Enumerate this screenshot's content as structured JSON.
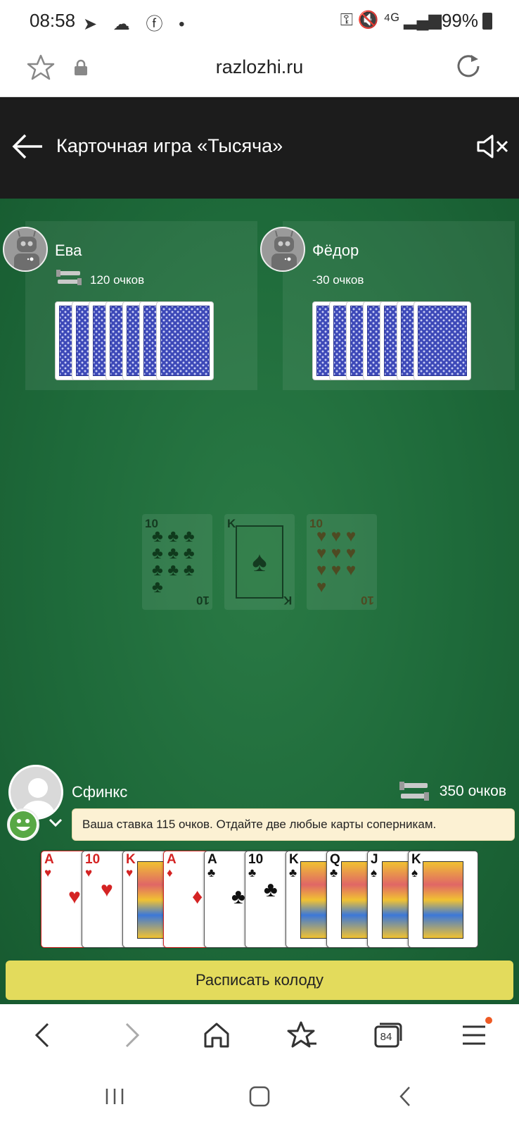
{
  "status_bar": {
    "time": "08:58",
    "left_icons": "➤ ☁ ⓕ •",
    "right_icons": "⚿ 🔇 ⁴ᴳ ▂▄▆",
    "battery": "99%"
  },
  "browser": {
    "url": "razlozhi.ru",
    "tabs_count": "84"
  },
  "header": {
    "title": "Карточная игра «Тысяча»"
  },
  "opponents": [
    {
      "name": "Ева",
      "score": "120 очков"
    },
    {
      "name": "Фёдор",
      "score": "-30 очков"
    }
  ],
  "trick": [
    {
      "rank": "10",
      "suit": "♣",
      "color": "black",
      "pips": "♣ ♣ ♣ ♣ ♣ ♣ ♣ ♣ ♣ ♣"
    },
    {
      "rank": "K",
      "suit": "♠",
      "color": "black",
      "pips": "K"
    },
    {
      "rank": "10",
      "suit": "♥",
      "color": "red",
      "pips": "♥ ♥ ♥ ♥ ♥ ♥ ♥ ♥ ♥ ♥"
    }
  ],
  "me": {
    "name": "Сфинкс",
    "score": "350 очков",
    "message": "Ваша ставка 115 очков. Отдайте две любые карты соперникам."
  },
  "hand": [
    {
      "rank": "A",
      "suit": "♥",
      "color": "red"
    },
    {
      "rank": "10",
      "suit": "♥",
      "color": "red"
    },
    {
      "rank": "K",
      "suit": "♥",
      "color": "red"
    },
    {
      "rank": "A",
      "suit": "♦",
      "color": "red"
    },
    {
      "rank": "A",
      "suit": "♣",
      "color": "black"
    },
    {
      "rank": "10",
      "suit": "♣",
      "color": "black"
    },
    {
      "rank": "K",
      "suit": "♣",
      "color": "black"
    },
    {
      "rank": "Q",
      "suit": "♣",
      "color": "black"
    },
    {
      "rank": "J",
      "suit": "♠",
      "color": "black"
    },
    {
      "rank": "K",
      "suit": "♠",
      "color": "black"
    }
  ],
  "deal_button": "Расписать колоду",
  "colors": {
    "table_green": "#1e6a3a",
    "header_dark": "#1c1c1c",
    "button_yellow": "#e3db5c",
    "message_bg": "#fcf1d3"
  }
}
